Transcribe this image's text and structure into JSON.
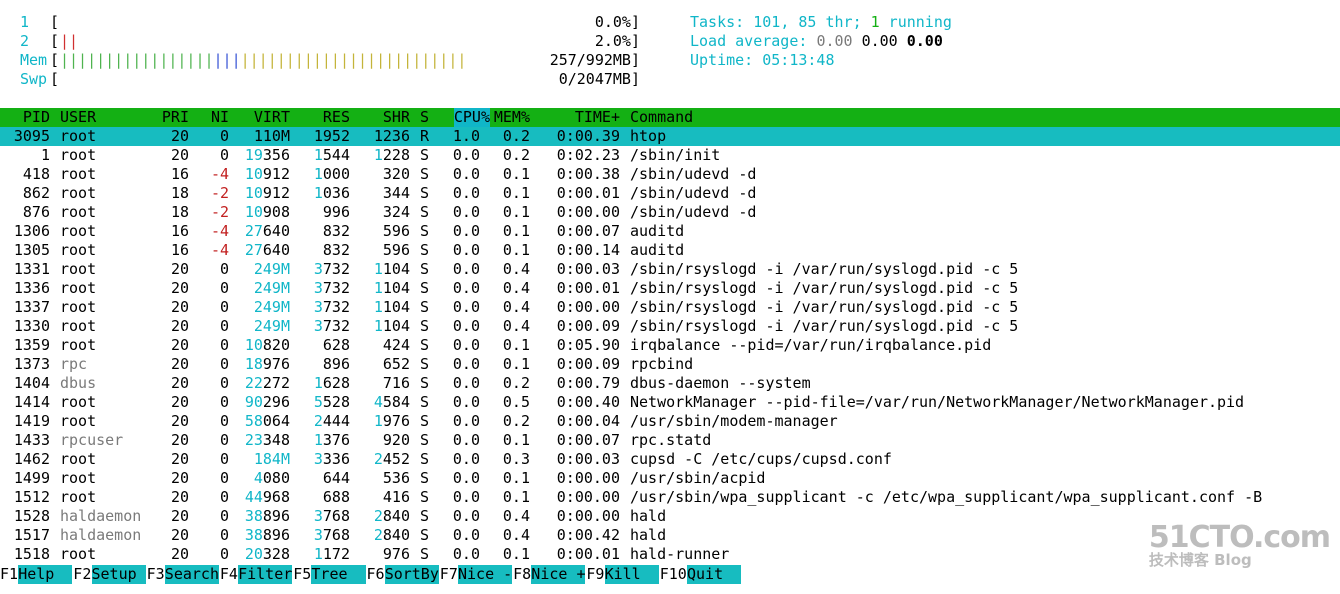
{
  "meters": [
    {
      "label": "1",
      "bars": [],
      "value": "0.0%]"
    },
    {
      "label": "2",
      "bars": [
        {
          "c": "r",
          "t": "|"
        },
        {
          "c": "r",
          "t": "|"
        }
      ],
      "value": "2.0%]"
    },
    {
      "label": "Mem",
      "bars": [
        {
          "c": "g",
          "t": "|||||||||||||||||"
        },
        {
          "c": "b",
          "t": "|||"
        },
        {
          "c": "y",
          "t": "|||||||||||||||||||||||||"
        }
      ],
      "value": "257/992MB]"
    },
    {
      "label": "Swp",
      "bars": [],
      "value": "0/2047MB]"
    }
  ],
  "tasks": {
    "label": "Tasks: ",
    "count": "101",
    "sep1": ", ",
    "thr": "85 thr",
    "sep2": "; ",
    "running": "1",
    "running_label": " running"
  },
  "load": {
    "label": "Load average: ",
    "v1": "0.00",
    "v2": "0.00",
    "v3": "0.00"
  },
  "uptime": {
    "label": "Uptime: ",
    "value": "05:13:48"
  },
  "header": {
    "pid": "PID",
    "user": "USER",
    "pri": "PRI",
    "ni": "NI",
    "virt": "VIRT",
    "res": "RES",
    "shr": "SHR",
    "s": "S",
    "cpu": "CPU%",
    "mem": "MEM%",
    "time": "TIME+",
    "cmd": "Command"
  },
  "processes": [
    {
      "pid": "3095",
      "user": "root",
      "pri": "20",
      "ni": "0",
      "virt": "110M",
      "res": "1952",
      "shr": "1236",
      "s": "R",
      "cpu": "1.0",
      "mem": "0.2",
      "time": "0:00.39",
      "cmd": "htop"
    },
    {
      "pid": "1",
      "user": "root",
      "pri": "20",
      "ni": "0",
      "virt": "19356",
      "res": "1544",
      "shr": "1228",
      "s": "S",
      "cpu": "0.0",
      "mem": "0.2",
      "time": "0:02.23",
      "cmd": "/sbin/init"
    },
    {
      "pid": "418",
      "user": "root",
      "pri": "16",
      "ni": "-4",
      "virt": "10912",
      "res": "1000",
      "shr": "320",
      "s": "S",
      "cpu": "0.0",
      "mem": "0.1",
      "time": "0:00.38",
      "cmd": "/sbin/udevd -d"
    },
    {
      "pid": "862",
      "user": "root",
      "pri": "18",
      "ni": "-2",
      "virt": "10912",
      "res": "1036",
      "shr": "344",
      "s": "S",
      "cpu": "0.0",
      "mem": "0.1",
      "time": "0:00.01",
      "cmd": "/sbin/udevd -d"
    },
    {
      "pid": "876",
      "user": "root",
      "pri": "18",
      "ni": "-2",
      "virt": "10908",
      "res": "996",
      "shr": "324",
      "s": "S",
      "cpu": "0.0",
      "mem": "0.1",
      "time": "0:00.00",
      "cmd": "/sbin/udevd -d"
    },
    {
      "pid": "1306",
      "user": "root",
      "pri": "16",
      "ni": "-4",
      "virt": "27640",
      "res": "832",
      "shr": "596",
      "s": "S",
      "cpu": "0.0",
      "mem": "0.1",
      "time": "0:00.07",
      "cmd": "auditd"
    },
    {
      "pid": "1305",
      "user": "root",
      "pri": "16",
      "ni": "-4",
      "virt": "27640",
      "res": "832",
      "shr": "596",
      "s": "S",
      "cpu": "0.0",
      "mem": "0.1",
      "time": "0:00.14",
      "cmd": "auditd"
    },
    {
      "pid": "1331",
      "user": "root",
      "pri": "20",
      "ni": "0",
      "virt": "249M",
      "res": "3732",
      "shr": "1104",
      "s": "S",
      "cpu": "0.0",
      "mem": "0.4",
      "time": "0:00.03",
      "cmd": "/sbin/rsyslogd -i /var/run/syslogd.pid -c 5"
    },
    {
      "pid": "1336",
      "user": "root",
      "pri": "20",
      "ni": "0",
      "virt": "249M",
      "res": "3732",
      "shr": "1104",
      "s": "S",
      "cpu": "0.0",
      "mem": "0.4",
      "time": "0:00.01",
      "cmd": "/sbin/rsyslogd -i /var/run/syslogd.pid -c 5"
    },
    {
      "pid": "1337",
      "user": "root",
      "pri": "20",
      "ni": "0",
      "virt": "249M",
      "res": "3732",
      "shr": "1104",
      "s": "S",
      "cpu": "0.0",
      "mem": "0.4",
      "time": "0:00.00",
      "cmd": "/sbin/rsyslogd -i /var/run/syslogd.pid -c 5"
    },
    {
      "pid": "1330",
      "user": "root",
      "pri": "20",
      "ni": "0",
      "virt": "249M",
      "res": "3732",
      "shr": "1104",
      "s": "S",
      "cpu": "0.0",
      "mem": "0.4",
      "time": "0:00.09",
      "cmd": "/sbin/rsyslogd -i /var/run/syslogd.pid -c 5"
    },
    {
      "pid": "1359",
      "user": "root",
      "pri": "20",
      "ni": "0",
      "virt": "10820",
      "res": "628",
      "shr": "424",
      "s": "S",
      "cpu": "0.0",
      "mem": "0.1",
      "time": "0:05.90",
      "cmd": "irqbalance --pid=/var/run/irqbalance.pid"
    },
    {
      "pid": "1373",
      "user": "rpc",
      "pri": "20",
      "ni": "0",
      "virt": "18976",
      "res": "896",
      "shr": "652",
      "s": "S",
      "cpu": "0.0",
      "mem": "0.1",
      "time": "0:00.09",
      "cmd": "rpcbind"
    },
    {
      "pid": "1404",
      "user": "dbus",
      "pri": "20",
      "ni": "0",
      "virt": "22272",
      "res": "1628",
      "shr": "716",
      "s": "S",
      "cpu": "0.0",
      "mem": "0.2",
      "time": "0:00.79",
      "cmd": "dbus-daemon --system"
    },
    {
      "pid": "1414",
      "user": "root",
      "pri": "20",
      "ni": "0",
      "virt": "90296",
      "res": "5528",
      "shr": "4584",
      "s": "S",
      "cpu": "0.0",
      "mem": "0.5",
      "time": "0:00.40",
      "cmd": "NetworkManager --pid-file=/var/run/NetworkManager/NetworkManager.pid"
    },
    {
      "pid": "1419",
      "user": "root",
      "pri": "20",
      "ni": "0",
      "virt": "58064",
      "res": "2444",
      "shr": "1976",
      "s": "S",
      "cpu": "0.0",
      "mem": "0.2",
      "time": "0:00.04",
      "cmd": "/usr/sbin/modem-manager"
    },
    {
      "pid": "1433",
      "user": "rpcuser",
      "pri": "20",
      "ni": "0",
      "virt": "23348",
      "res": "1376",
      "shr": "920",
      "s": "S",
      "cpu": "0.0",
      "mem": "0.1",
      "time": "0:00.07",
      "cmd": "rpc.statd"
    },
    {
      "pid": "1462",
      "user": "root",
      "pri": "20",
      "ni": "0",
      "virt": "184M",
      "res": "3336",
      "shr": "2452",
      "s": "S",
      "cpu": "0.0",
      "mem": "0.3",
      "time": "0:00.03",
      "cmd": "cupsd -C /etc/cups/cupsd.conf"
    },
    {
      "pid": "1499",
      "user": "root",
      "pri": "20",
      "ni": "0",
      "virt": "4080",
      "res": "644",
      "shr": "536",
      "s": "S",
      "cpu": "0.0",
      "mem": "0.1",
      "time": "0:00.00",
      "cmd": "/usr/sbin/acpid"
    },
    {
      "pid": "1512",
      "user": "root",
      "pri": "20",
      "ni": "0",
      "virt": "44968",
      "res": "688",
      "shr": "416",
      "s": "S",
      "cpu": "0.0",
      "mem": "0.1",
      "time": "0:00.00",
      "cmd": "/usr/sbin/wpa_supplicant -c /etc/wpa_supplicant/wpa_supplicant.conf -B"
    },
    {
      "pid": "1528",
      "user": "haldaemon",
      "pri": "20",
      "ni": "0",
      "virt": "38896",
      "res": "3768",
      "shr": "2840",
      "s": "S",
      "cpu": "0.0",
      "mem": "0.4",
      "time": "0:00.00",
      "cmd": "hald"
    },
    {
      "pid": "1517",
      "user": "haldaemon",
      "pri": "20",
      "ni": "0",
      "virt": "38896",
      "res": "3768",
      "shr": "2840",
      "s": "S",
      "cpu": "0.0",
      "mem": "0.4",
      "time": "0:00.42",
      "cmd": "hald"
    },
    {
      "pid": "1518",
      "user": "root",
      "pri": "20",
      "ni": "0",
      "virt": "20328",
      "res": "1172",
      "shr": "976",
      "s": "S",
      "cpu": "0.0",
      "mem": "0.1",
      "time": "0:00.01",
      "cmd": "hald-runner"
    }
  ],
  "fkeys": [
    {
      "key": "F1",
      "label": "Help  "
    },
    {
      "key": "F2",
      "label": "Setup "
    },
    {
      "key": "F3",
      "label": "Search"
    },
    {
      "key": "F4",
      "label": "Filter"
    },
    {
      "key": "F5",
      "label": "Tree  "
    },
    {
      "key": "F6",
      "label": "SortBy"
    },
    {
      "key": "F7",
      "label": "Nice -"
    },
    {
      "key": "F8",
      "label": "Nice +"
    },
    {
      "key": "F9",
      "label": "Kill  "
    },
    {
      "key": "F10",
      "label": "Quit  "
    }
  ],
  "watermark": {
    "brand": "51CTO.com",
    "sub": "技术博客",
    "blog": "Blog"
  },
  "colors": {
    "header_bg": "#14b014",
    "selected_bg": "#17bcc0",
    "accent_cyan": "#10b6c8"
  }
}
